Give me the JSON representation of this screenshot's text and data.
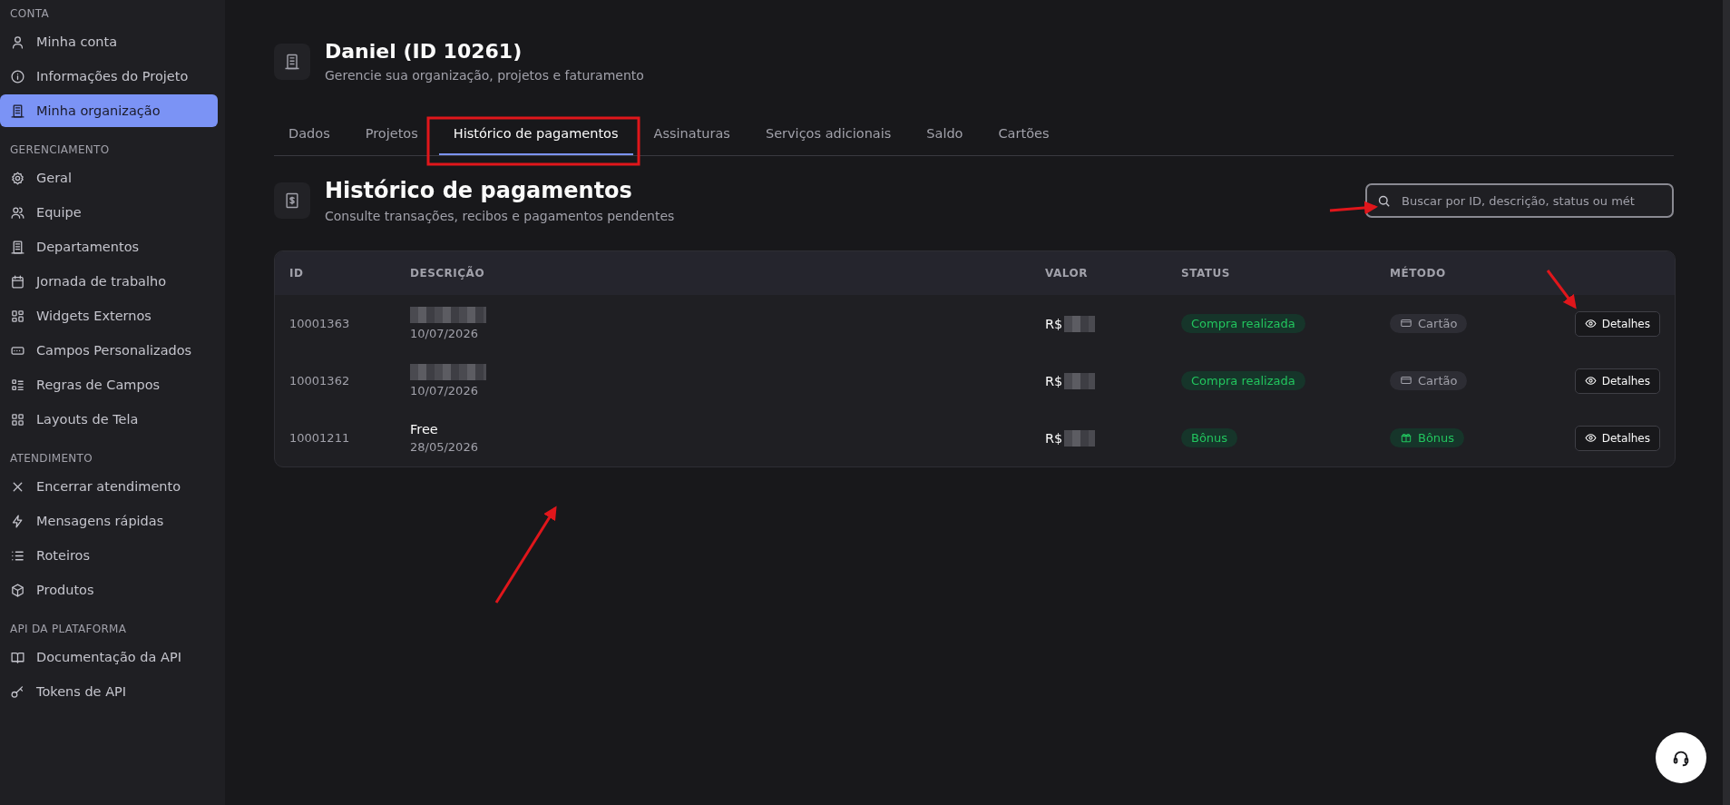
{
  "sidebar": {
    "sections": [
      {
        "title": "CONTA",
        "items": [
          {
            "label": "Minha conta",
            "kind": "user",
            "selected": false
          },
          {
            "label": "Informações do Projeto",
            "kind": "info",
            "selected": false
          },
          {
            "label": "Minha organização",
            "kind": "building",
            "selected": true
          }
        ]
      },
      {
        "title": "GERENCIAMENTO",
        "items": [
          {
            "label": "Geral",
            "kind": "gear",
            "selected": false
          },
          {
            "label": "Equipe",
            "kind": "users",
            "selected": false
          },
          {
            "label": "Departamentos",
            "kind": "building",
            "selected": false
          },
          {
            "label": "Jornada de trabalho",
            "kind": "calendar",
            "selected": false
          },
          {
            "label": "Widgets Externos",
            "kind": "widgets",
            "selected": false
          },
          {
            "label": "Campos Personalizados",
            "kind": "field",
            "selected": false
          },
          {
            "label": "Regras de Campos",
            "kind": "rules",
            "selected": false
          },
          {
            "label": "Layouts de Tela",
            "kind": "grid",
            "selected": false
          }
        ]
      },
      {
        "title": "ATENDIMENTO",
        "items": [
          {
            "label": "Encerrar atendimento",
            "kind": "close",
            "selected": false
          },
          {
            "label": "Mensagens rápidas",
            "kind": "bolt",
            "selected": false
          },
          {
            "label": "Roteiros",
            "kind": "list",
            "selected": false
          },
          {
            "label": "Produtos",
            "kind": "box",
            "selected": false
          }
        ]
      },
      {
        "title": "API DA PLATAFORMA",
        "items": [
          {
            "label": "Documentação da API",
            "kind": "book",
            "selected": false
          },
          {
            "label": "Tokens de API",
            "kind": "key",
            "selected": false
          }
        ]
      }
    ]
  },
  "header": {
    "title": "Daniel (ID 10261)",
    "subtitle": "Gerencie sua organização, projetos e faturamento"
  },
  "tabs": [
    {
      "label": "Dados",
      "selected": false
    },
    {
      "label": "Projetos",
      "selected": false
    },
    {
      "label": "Histórico de pagamentos",
      "selected": true
    },
    {
      "label": "Assinaturas",
      "selected": false
    },
    {
      "label": "Serviços adicionais",
      "selected": false
    },
    {
      "label": "Saldo",
      "selected": false
    },
    {
      "label": "Cartões",
      "selected": false
    }
  ],
  "section": {
    "title": "Histórico de pagamentos",
    "subtitle": "Consulte transações, recibos e pagamentos pendentes"
  },
  "search": {
    "placeholder": "Buscar por ID, descrição, status ou mét"
  },
  "table": {
    "columns": [
      "ID",
      "DESCRIÇÃO",
      "VALOR",
      "STATUS",
      "MÉTODO"
    ],
    "rows": [
      {
        "id": "10001363",
        "date": "10/07/2026",
        "value_prefix": "R$",
        "status": "Compra realizada",
        "method": {
          "kind": "card",
          "label": "Cartão"
        },
        "action": "Detalhes"
      },
      {
        "id": "10001362",
        "date": "10/07/2026",
        "value_prefix": "R$",
        "status": "Compra realizada",
        "method": {
          "kind": "card",
          "label": "Cartão"
        },
        "action": "Detalhes"
      },
      {
        "id": "10001211",
        "description": "Free",
        "date": "28/05/2026",
        "value_prefix": "R$",
        "status": "Bônus",
        "method": {
          "kind": "bonus",
          "label": "Bônus"
        },
        "action": "Detalhes"
      }
    ]
  }
}
